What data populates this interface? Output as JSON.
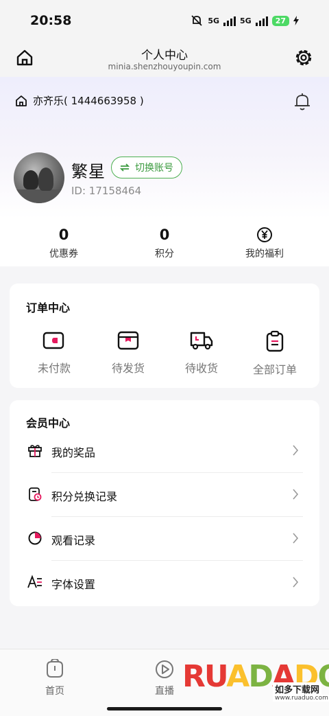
{
  "status_bar": {
    "time": "20:58",
    "network1": "5G",
    "network2": "5G",
    "battery": "27"
  },
  "nav": {
    "title": "个人中心",
    "subtitle": "minia.shenzhouyoupin.com"
  },
  "store": {
    "name": "亦齐乐( 1444663958 )"
  },
  "profile": {
    "username": "繁星",
    "switch_label": "切换账号",
    "user_id": "ID: 17158464"
  },
  "stats": [
    {
      "value": "0",
      "label": "优惠券"
    },
    {
      "value": "0",
      "label": "积分"
    },
    {
      "value": "",
      "label": "我的福利"
    }
  ],
  "orders": {
    "title": "订单中心",
    "items": [
      {
        "label": "未付款",
        "icon": "wallet-icon"
      },
      {
        "label": "待发货",
        "icon": "box-icon"
      },
      {
        "label": "待收货",
        "icon": "truck-icon"
      },
      {
        "label": "全部订单",
        "icon": "clipboard-icon"
      }
    ]
  },
  "member": {
    "title": "会员中心",
    "items": [
      {
        "label": "我的奖品",
        "icon": "gift-icon"
      },
      {
        "label": "积分兑换记录",
        "icon": "exchange-record-icon"
      },
      {
        "label": "观看记录",
        "icon": "pie-chart-icon"
      },
      {
        "label": "字体设置",
        "icon": "font-icon"
      }
    ]
  },
  "tabs": [
    {
      "label": "首页",
      "icon": "home-tab-icon"
    },
    {
      "label": "直播",
      "icon": "play-icon"
    }
  ],
  "watermark": {
    "brand": "RUANDADO",
    "sub": "如多下载网",
    "url": "www.ruaduo.com"
  },
  "colors": {
    "accent_pink": "#e5195e",
    "switch_green": "#4caf50"
  }
}
